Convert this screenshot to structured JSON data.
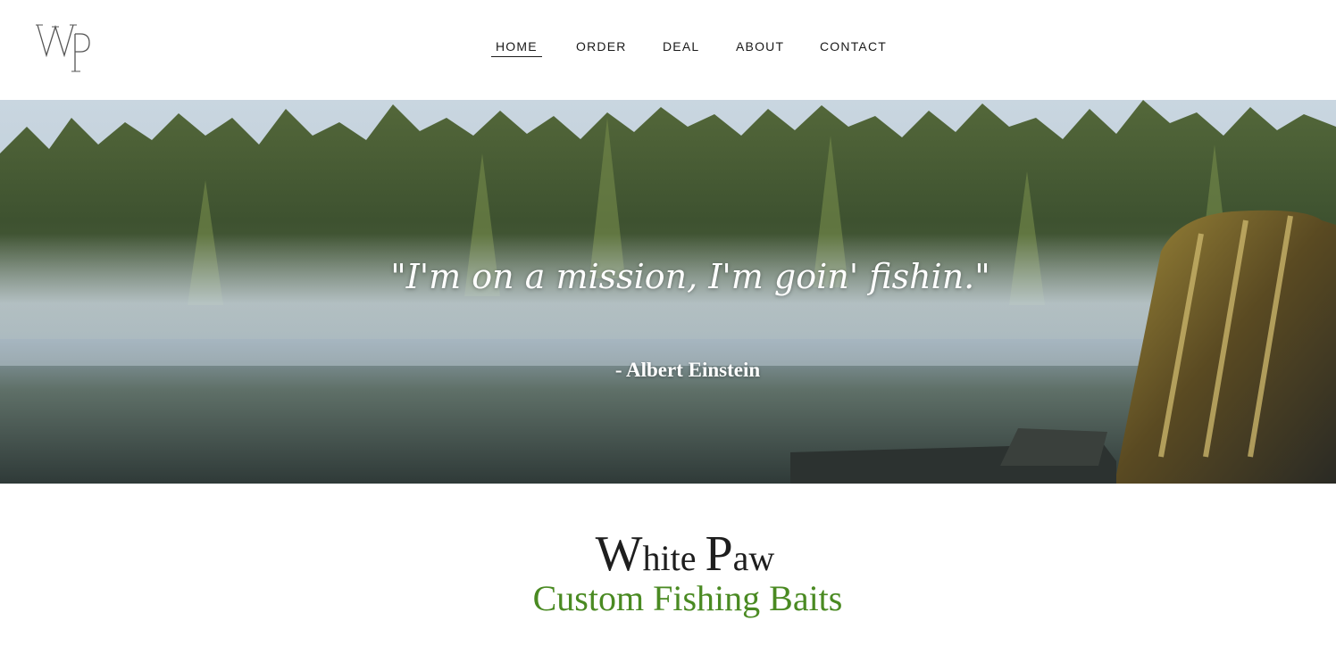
{
  "logo": {
    "text": "WP",
    "icon": "wp-monogram-logo"
  },
  "nav": {
    "items": [
      {
        "label": "HOME",
        "active": true
      },
      {
        "label": "ORDER",
        "active": false
      },
      {
        "label": "DEAL",
        "active": false
      },
      {
        "label": "ABOUT",
        "active": false
      },
      {
        "label": "CONTACT",
        "active": false
      }
    ]
  },
  "hero": {
    "quote": "\"I'm on a mission, I'm goin' fishin.\"",
    "author": "- Albert Einstein"
  },
  "brand": {
    "name_w": "W",
    "name_hite": "hite ",
    "name_p": "P",
    "name_aw": "aw",
    "tagline": "Custom Fishing Baits"
  },
  "colors": {
    "tagline": "#4a8a22",
    "nav_text": "#1a1a1a"
  }
}
